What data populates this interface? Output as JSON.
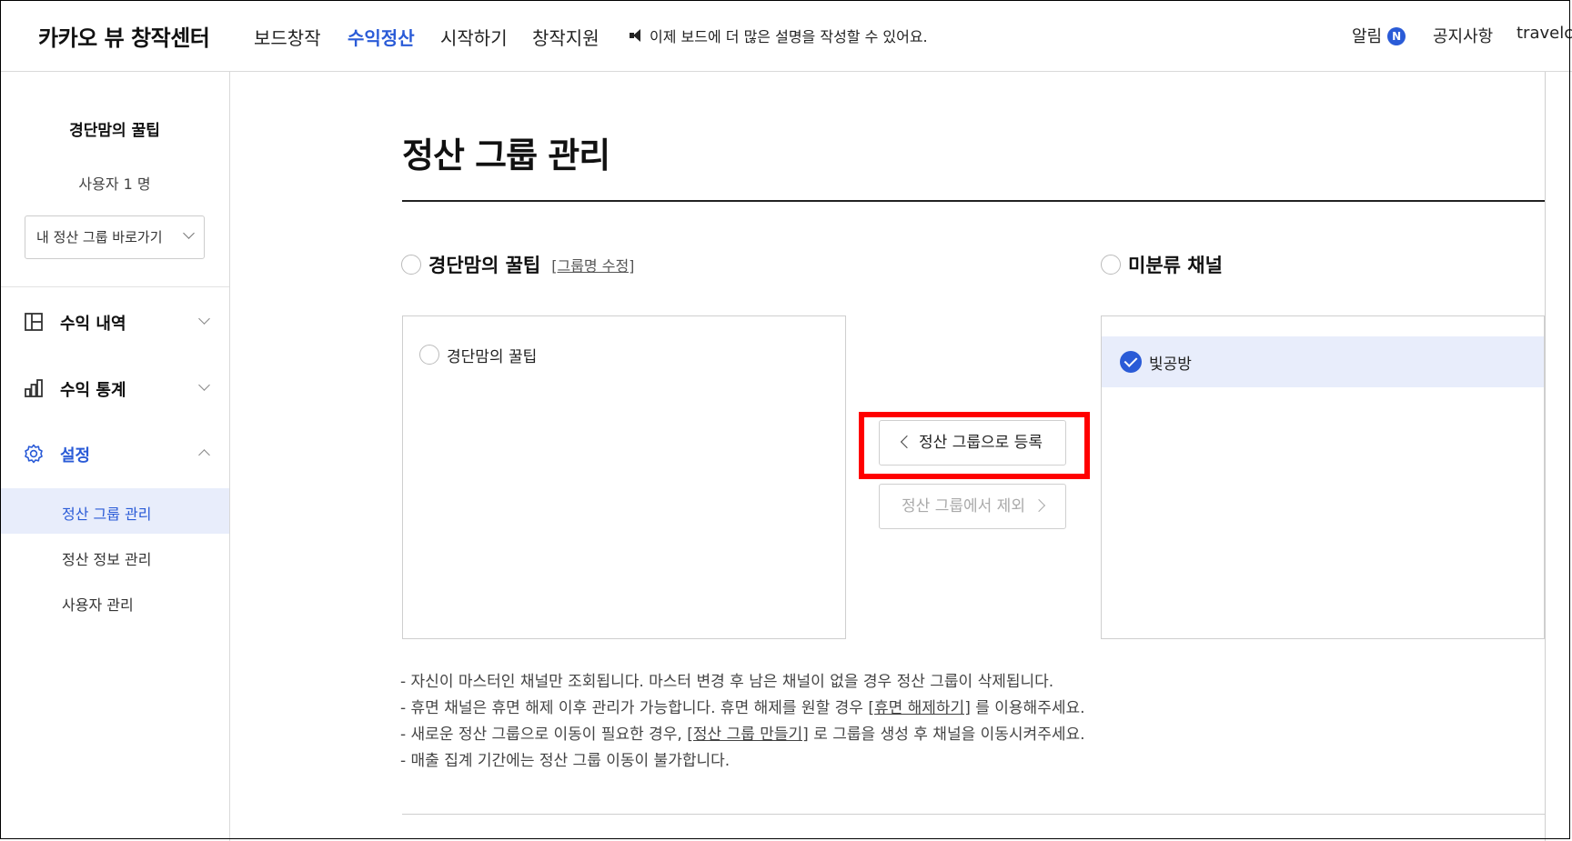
{
  "header": {
    "brand": "카카오 뷰 창작센터",
    "nav": [
      "보드창작",
      "수익정산",
      "시작하기",
      "창작지원"
    ],
    "active_nav": "수익정산",
    "notice": "이제 보드에 더 많은 설명을 작성할 수 있어요.",
    "alarm_label": "알림",
    "alarm_badge": "N",
    "announcement": "공지사항",
    "user": "travelca"
  },
  "sidebar": {
    "title": "경단맘의 꿀팁",
    "user_count": "사용자 1 명",
    "group_select": "내 정산 그룹 바로가기",
    "menus": [
      {
        "label": "수익 내역",
        "icon": "layout-icon"
      },
      {
        "label": "수익 통계",
        "icon": "bar-chart-icon"
      },
      {
        "label": "설정",
        "icon": "gear-icon"
      }
    ],
    "submenu": [
      "정산 그룹 관리",
      "정산 정보 관리",
      "사용자 관리"
    ]
  },
  "main": {
    "title": "정산 그룹 관리",
    "left_group_name": "경단맘의 꿀팁",
    "edit_group_name": "[그룹명 수정]",
    "right_group_name": "미분류 채널",
    "left_channels": [
      "경단맘의 꿀팁"
    ],
    "right_channels": [
      "빛공방"
    ],
    "register_button": "정산 그룹으로 등록",
    "remove_button": "정산 그룹에서 제외",
    "notes": {
      "line1": "- 자신이 마스터인 채널만 조회됩니다. 마스터 변경 후 남은 채널이 없을 경우 정산 그룹이 삭제됩니다.",
      "line2_pre": "- 휴면 채널은 휴면 해제 이후 관리가 가능합니다. 휴면 해제를 원할 경우 ",
      "line2_link": "[휴면 해제하기]",
      "line2_post": " 를 이용해주세요.",
      "line3_pre": "- 새로운 정산 그룹으로 이동이 필요한 경우, ",
      "line3_link": "[정산 그룹 만들기]",
      "line3_post": " 로 그룹을 생성 후 채널을 이동시켜주세요.",
      "line4": "- 매출 집계 기간에는 정산 그룹 이동이 불가합니다."
    }
  },
  "colors": {
    "accent": "#2a5bd7",
    "selected_row": "#e8edfb",
    "highlight": "#ff0000"
  }
}
